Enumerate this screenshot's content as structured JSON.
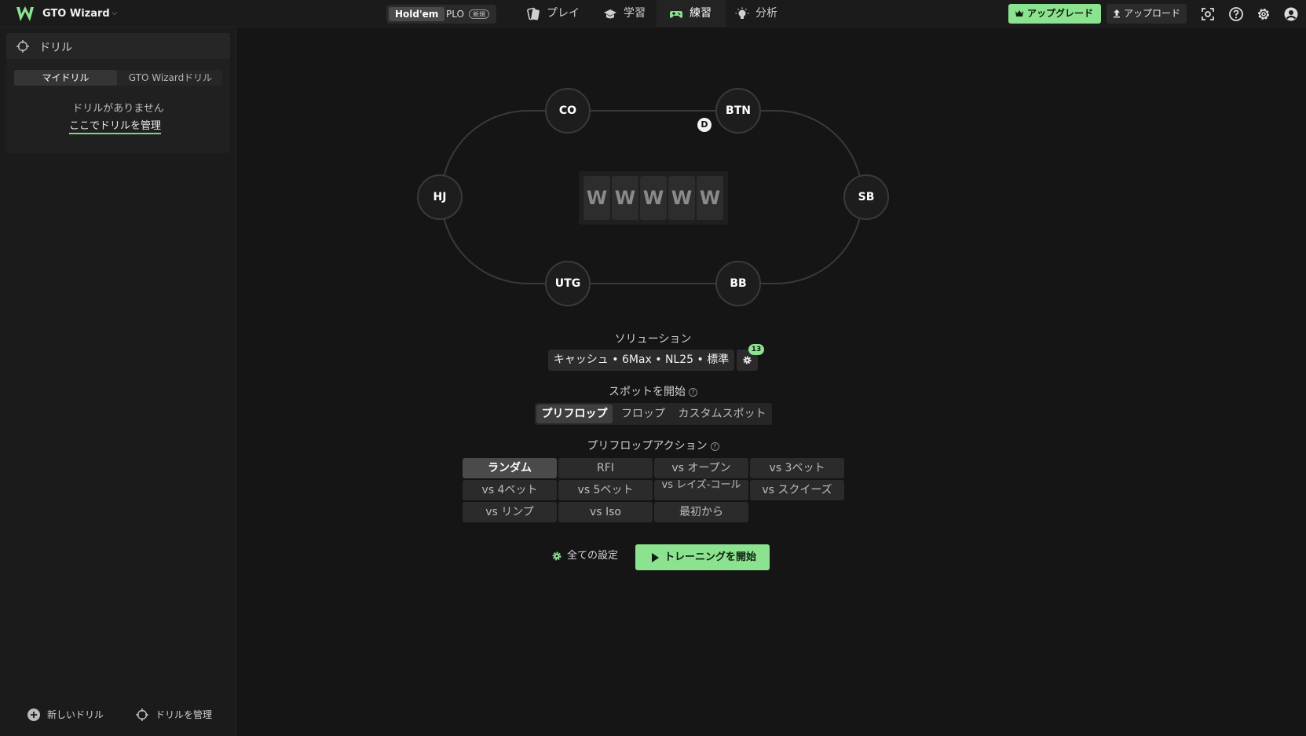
{
  "header": {
    "brand": "GTO Wizard",
    "game_toggle": {
      "holdem": "Hold'em",
      "plo": "PLO",
      "plo_badge": "新規"
    },
    "nav": [
      {
        "label": "プレイ",
        "icon": "cards-icon"
      },
      {
        "label": "学習",
        "icon": "graduation-cap-icon"
      },
      {
        "label": "練習",
        "icon": "gamepad-icon",
        "active": true
      },
      {
        "label": "分析",
        "icon": "lightbulb-icon"
      }
    ],
    "upgrade_label": "アップグレード",
    "upload_label": "アップロード"
  },
  "sidebar": {
    "panel_title": "ドリル",
    "tabs": [
      "マイドリル",
      "GTO Wizardドリル"
    ],
    "empty_text": "ドリルがありません",
    "manage_link": "ここでドリルを管理",
    "footer_new": "新しいドリル",
    "footer_manage": "ドリルを管理"
  },
  "table": {
    "seats": [
      "CO",
      "BTN",
      "HJ",
      "SB",
      "UTG",
      "BB"
    ],
    "dealer": "D",
    "card_glyph": "W"
  },
  "solution": {
    "label": "ソリューション",
    "value": "キャッシュ • 6Max • NL25 • 標準",
    "badge": "13"
  },
  "spot": {
    "label": "スポットを開始",
    "options": [
      "プリフロップ",
      "フロップ",
      "カスタムスポット"
    ],
    "selected": "プリフロップ"
  },
  "preflop": {
    "label": "プリフロップアクション",
    "actions": [
      "ランダム",
      "RFI",
      "vs オープン",
      "vs 3ベット",
      "vs 4ベット",
      "vs 5ベット",
      "vs レイズ-コール",
      "vs スクイーズ",
      "vs リンプ",
      "vs Iso",
      "最初から"
    ],
    "selected": "ランダム"
  },
  "footer_actions": {
    "all_settings": "全ての設定",
    "start_training": "トレーニングを開始"
  },
  "colors": {
    "accent": "#8ce38f",
    "background": "#151515",
    "sidebar": "#1b1b1b"
  }
}
